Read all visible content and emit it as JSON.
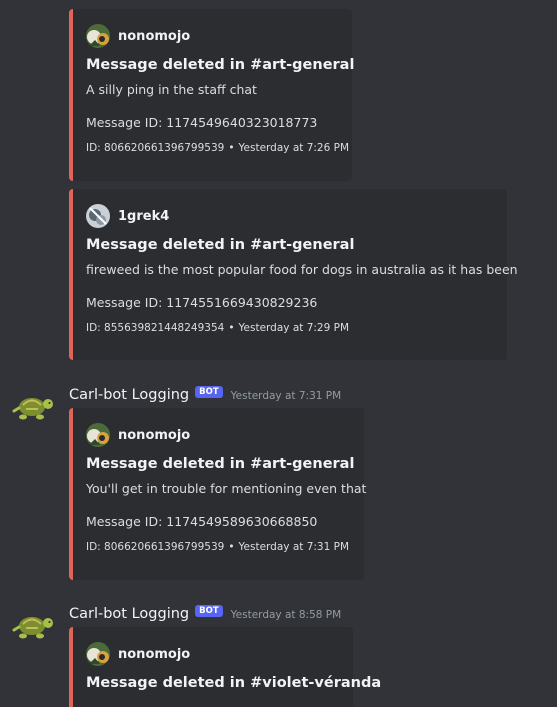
{
  "colors": {
    "background": "#313338",
    "embed_bg": "#2b2d31",
    "embed_accent": "#e1645b",
    "bot_tag": "#5865f2"
  },
  "embeds": [
    {
      "author": "nonomojo",
      "author_icon": "cat-avatar-icon",
      "title": "Message deleted in #art-general",
      "description": "A silly ping in the staff chat",
      "message_id": "Message ID: 1174549640323018773",
      "footer_id": "ID: 806620661396799539",
      "footer_sep": "•",
      "footer_time": "Yesterday at 7:26 PM"
    },
    {
      "author": "1grek4",
      "author_icon": "grey-avatar-icon",
      "title": "Message deleted in #art-general",
      "description": "fireweed is the most popular food for dogs in australia as it has been",
      "message_id": "Message ID: 1174551669430829236",
      "footer_id": "ID: 855639821448249354",
      "footer_sep": "•",
      "footer_time": "Yesterday at 7:29 PM"
    },
    {
      "author": "nonomojo",
      "author_icon": "cat-avatar-icon",
      "title": "Message deleted in #art-general",
      "description": "You'll get in trouble for mentioning even that",
      "message_id": "Message ID: 1174549589630668850",
      "footer_id": "ID: 806620661396799539",
      "footer_sep": "•",
      "footer_time": "Yesterday at 7:31 PM"
    },
    {
      "author": "nonomojo",
      "author_icon": "cat-avatar-icon",
      "title": "Message deleted in #violet-véranda"
    }
  ],
  "messages": [
    {
      "bot_name": "Carl-bot Logging",
      "bot_tag": "BOT",
      "timestamp": "Yesterday at 7:31 PM",
      "avatar_icon": "turtle-avatar-icon"
    },
    {
      "bot_name": "Carl-bot Logging",
      "bot_tag": "BOT",
      "timestamp": "Yesterday at 8:58 PM",
      "avatar_icon": "turtle-avatar-icon"
    }
  ]
}
